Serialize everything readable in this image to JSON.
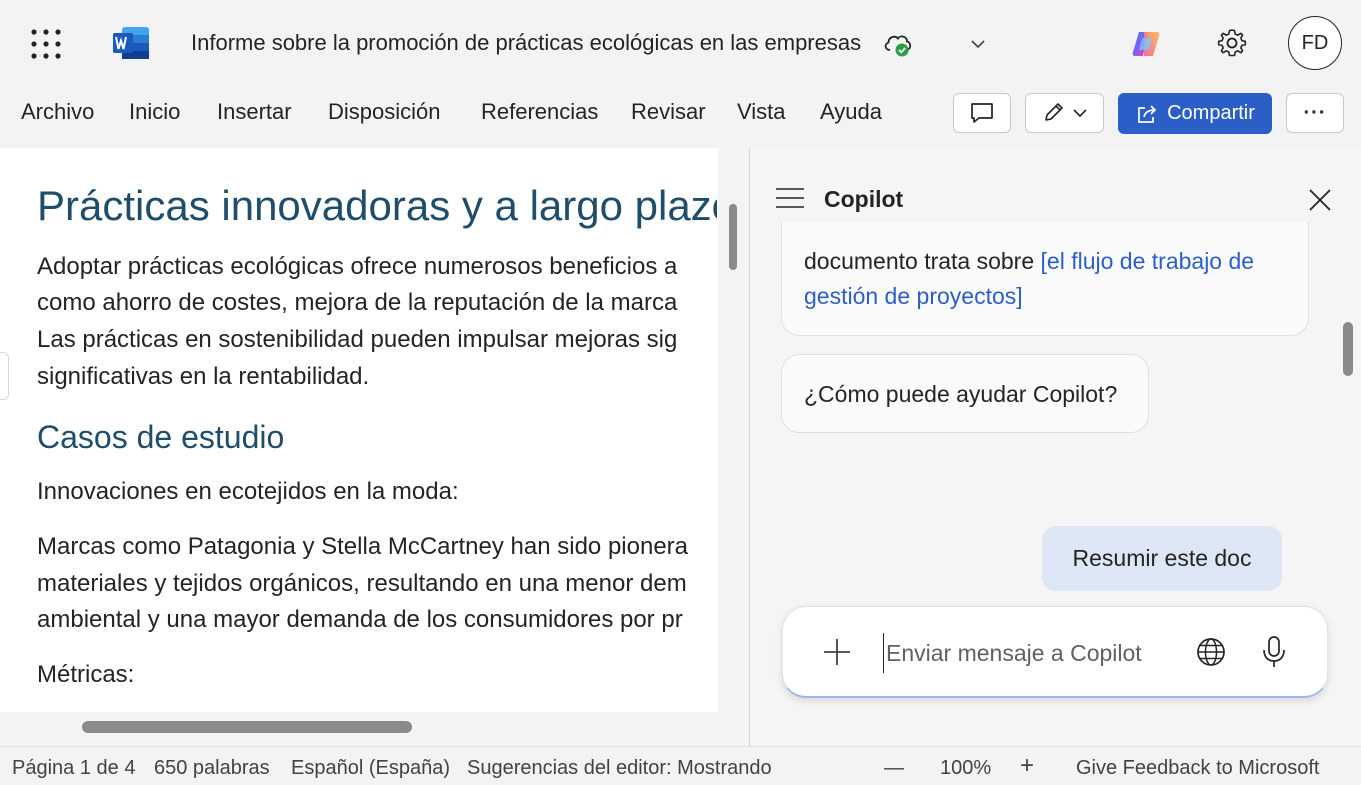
{
  "titlebar": {
    "document_title": "Informe sobre la promoción de prácticas ecológicas en las empresas",
    "avatar_initials": "FD",
    "icons": [
      "apps-grid-icon",
      "word-app-icon",
      "cloud-saved-icon",
      "chevron-down-icon",
      "copilot-logo-icon",
      "gear-icon"
    ]
  },
  "ribbon": {
    "menu": [
      "Archivo",
      "Inicio",
      "Insertar",
      "Disposición",
      "Referencias",
      "Revisar",
      "Vista",
      "Ayuda"
    ],
    "share_label": "Compartir",
    "more_label": "···",
    "accent_color": "#2b5fc7"
  },
  "document": {
    "heading1": "Prácticas innovadoras y a largo plazo.",
    "para1": [
      "Adoptar prácticas ecológicas ofrece numerosos beneficios a",
      "como ahorro de costes, mejora de la reputación de la marca",
      "Las prácticas en sostenibilidad pueden impulsar mejoras sig",
      "significativas en la rentabilidad."
    ],
    "heading2": "Casos de estudio",
    "para2": "Innovaciones en ecotejidos en la moda:",
    "para3": [
      "Marcas como Patagonia y Stella McCartney han sido pionera",
      "materiales y tejidos orgánicos, resultando en una menor dem",
      "ambiental y una mayor demanda de los consumidores por pr"
    ],
    "para4": "Métricas:",
    "heading_color": "#1f4e6b"
  },
  "copilot": {
    "title": "Copilot",
    "bubble1_text": "documento trata sobre ",
    "bubble1_link_a": "[el flujo de trabajo de",
    "bubble1_link_b": "gestión de proyectos]",
    "bubble2_text": "¿Cómo puede ayudar Copilot?",
    "user_message": "Resumir este doc",
    "composer_placeholder": "Enviar mensaje a Copilot"
  },
  "statusbar": {
    "page": "Página 1 de 4",
    "words": "650 palabras",
    "language": "Español (España)",
    "editor": "Sugerencias del editor: Mostrando",
    "zoom_out": "—",
    "zoom": "100%",
    "zoom_in": "+",
    "feedback": "Give Feedback to Microsoft"
  }
}
